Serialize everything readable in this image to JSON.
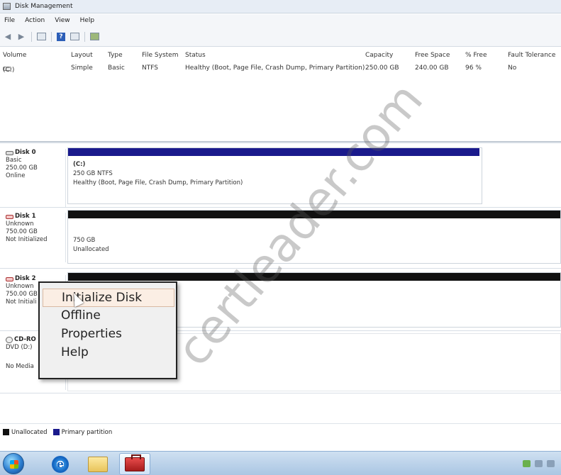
{
  "window": {
    "title": "Disk Management"
  },
  "menu": {
    "items": [
      "File",
      "Action",
      "View",
      "Help"
    ]
  },
  "toolbar": {
    "back_icon": "back-arrow-icon",
    "forward_icon": "forward-arrow-icon",
    "help_glyph": "?"
  },
  "volume_table": {
    "headers": {
      "volume": "Volume",
      "layout": "Layout",
      "type": "Type",
      "file_system": "File System",
      "status": "Status",
      "capacity": "Capacity",
      "free_space": "Free Space",
      "pct_free": "% Free",
      "fault_tolerance": "Fault Tolerance"
    },
    "rows": [
      {
        "volume": "(C:)",
        "layout": "Simple",
        "type": "Basic",
        "file_system": "NTFS",
        "status": "Healthy (Boot, Page File, Crash Dump, Primary Partition)",
        "capacity": "250.00 GB",
        "free_space": "240.00 GB",
        "pct_free": "96 %",
        "fault_tolerance": "No"
      }
    ]
  },
  "disks": [
    {
      "name": "Disk 0",
      "line1": "Basic",
      "line2": "250.00 GB",
      "line3": "Online",
      "partition": {
        "kind": "primary",
        "label": "(C:)",
        "size": "250 GB NTFS",
        "status": "Healthy (Boot, Page File, Crash Dump, Primary Partition)"
      }
    },
    {
      "name": "Disk 1",
      "line1": "Unknown",
      "line2": "750.00 GB",
      "line3": "Not Initialized",
      "partition": {
        "kind": "unallocated",
        "size": "750 GB",
        "status": "Unallocated"
      }
    },
    {
      "name": "Disk 2",
      "line1": "Unknown",
      "line2": "750.00 GB",
      "line3": "Not Initiali"
    },
    {
      "name": "CD-RO",
      "line1": "DVD (D:)",
      "line2": "",
      "line3": "No Media"
    }
  ],
  "context_menu": {
    "items": [
      "Initialize Disk",
      "Offline",
      "Properties",
      "Help"
    ],
    "highlighted_index": 0
  },
  "legend": {
    "items": [
      {
        "label": "Unallocated",
        "color": "#111111"
      },
      {
        "label": "Primary partition",
        "color": "#1a1a8c"
      }
    ]
  },
  "watermark": "certleader.com",
  "colors": {
    "primary_partition": "#1a1a8c",
    "unallocated": "#111111",
    "taskbar": "#aac6e3"
  }
}
